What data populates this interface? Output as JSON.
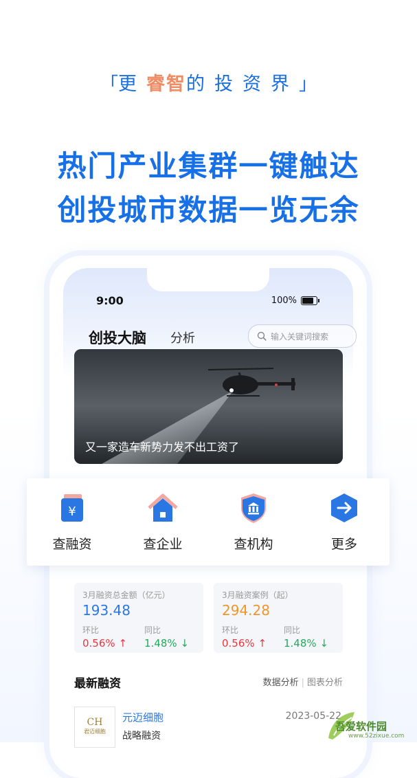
{
  "slogan": {
    "open": "「",
    "pre": "更",
    "highlight": "睿智",
    "post": "的投资界",
    "close": "」"
  },
  "headline": {
    "line1": "热门产业集群一键触达",
    "line2": "创投城市数据一览无余"
  },
  "status_bar": {
    "time": "9:00",
    "battery": "100%"
  },
  "app": {
    "title": "创投大脑",
    "tab": "分析",
    "search_placeholder": "输入关键词搜索"
  },
  "banner": {
    "caption": "又一家造车新势力发不出工资了"
  },
  "quick_actions": [
    {
      "label": "查融资",
      "icon": "yuan-clipboard-icon"
    },
    {
      "label": "查企业",
      "icon": "home-icon"
    },
    {
      "label": "查机构",
      "icon": "bank-shield-icon"
    },
    {
      "label": "更多",
      "icon": "arrow-hexagon-icon"
    }
  ],
  "stats": [
    {
      "title": "3月融资总金额（亿元）",
      "value": "193.48",
      "label_a": "环比",
      "label_b": "同比",
      "rate_a": "0.56%",
      "rate_b": "1.48%"
    },
    {
      "title": "3月融资案例（起）",
      "value": "294.28",
      "label_a": "环比",
      "label_b": "同比",
      "rate_a": "0.56%",
      "rate_b": "1.48%"
    }
  ],
  "latest": {
    "title": "最新融资",
    "link_a": "数据分析",
    "link_b": "图表分析",
    "items": [
      {
        "logo_text": "CH",
        "logo_sub": "君迈细胞",
        "name": "元迈细胞",
        "type": "战略融资",
        "date": "2023-05-22"
      }
    ]
  },
  "watermark": {
    "text": "吾爱软件园",
    "url": "www.52zixue.com"
  },
  "colors": {
    "brand_blue": "#1870e6",
    "accent_orange": "#ef8c63",
    "up_red": "#e8383d",
    "down_green": "#25a85b"
  }
}
